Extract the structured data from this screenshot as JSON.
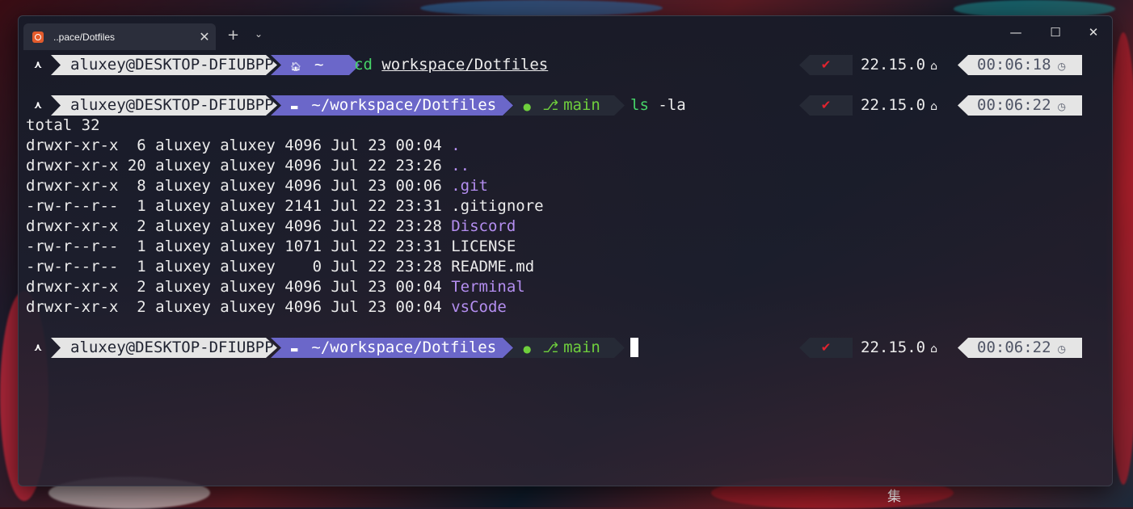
{
  "window": {
    "tab_title": "..pace/Dotfiles",
    "tab_close": "✕",
    "new_tab": "+",
    "dropdown": "⌄",
    "minimize": "—",
    "maximize": "☐",
    "close": "✕"
  },
  "prompts": [
    {
      "user": "aluxey@DESKTOP-DFIUBPP",
      "path_icon": "home-icon",
      "path": "~",
      "git_branch": null,
      "command_name": "cd",
      "command_arg": "workspace/Dotfiles",
      "status": "✔",
      "node_version": "22.15.0",
      "time": "00:06:18"
    },
    {
      "user": "aluxey@DESKTOP-DFIUBPP",
      "path_icon": "folder-icon",
      "path": "~/workspace/Dotfiles",
      "git_branch": "main",
      "command_name": "ls",
      "command_arg": "-la",
      "status": "✔",
      "node_version": "22.15.0",
      "time": "00:06:22"
    },
    {
      "user": "aluxey@DESKTOP-DFIUBPP",
      "path_icon": "folder-icon",
      "path": "~/workspace/Dotfiles",
      "git_branch": "main",
      "command_name": "",
      "command_arg": "",
      "status": "✔",
      "node_version": "22.15.0",
      "time": "00:06:22"
    }
  ],
  "ls_output": {
    "total": "total 32",
    "entries": [
      {
        "perms": "drwxr-xr-x",
        "links": " 6",
        "owner": "aluxey",
        "group": "aluxey",
        "size": "4096",
        "month": "Jul",
        "day": "23",
        "time": "00:04",
        "name": ".",
        "is_dir": true
      },
      {
        "perms": "drwxr-xr-x",
        "links": "20",
        "owner": "aluxey",
        "group": "aluxey",
        "size": "4096",
        "month": "Jul",
        "day": "22",
        "time": "23:26",
        "name": "..",
        "is_dir": true
      },
      {
        "perms": "drwxr-xr-x",
        "links": " 8",
        "owner": "aluxey",
        "group": "aluxey",
        "size": "4096",
        "month": "Jul",
        "day": "23",
        "time": "00:06",
        "name": ".git",
        "is_dir": true
      },
      {
        "perms": "-rw-r--r--",
        "links": " 1",
        "owner": "aluxey",
        "group": "aluxey",
        "size": "2141",
        "month": "Jul",
        "day": "22",
        "time": "23:31",
        "name": ".gitignore",
        "is_dir": false
      },
      {
        "perms": "drwxr-xr-x",
        "links": " 2",
        "owner": "aluxey",
        "group": "aluxey",
        "size": "4096",
        "month": "Jul",
        "day": "22",
        "time": "23:28",
        "name": "Discord",
        "is_dir": true
      },
      {
        "perms": "-rw-r--r--",
        "links": " 1",
        "owner": "aluxey",
        "group": "aluxey",
        "size": "1071",
        "month": "Jul",
        "day": "22",
        "time": "23:31",
        "name": "LICENSE",
        "is_dir": false
      },
      {
        "perms": "-rw-r--r--",
        "links": " 1",
        "owner": "aluxey",
        "group": "aluxey",
        "size": "   0",
        "month": "Jul",
        "day": "22",
        "time": "23:28",
        "name": "README.md",
        "is_dir": false
      },
      {
        "perms": "drwxr-xr-x",
        "links": " 2",
        "owner": "aluxey",
        "group": "aluxey",
        "size": "4096",
        "month": "Jul",
        "day": "23",
        "time": "00:04",
        "name": "Terminal",
        "is_dir": true
      },
      {
        "perms": "drwxr-xr-x",
        "links": " 2",
        "owner": "aluxey",
        "group": "aluxey",
        "size": "4096",
        "month": "Jul",
        "day": "23",
        "time": "00:04",
        "name": "vsCode",
        "is_dir": true
      }
    ]
  },
  "colors": {
    "user_segment_bg": "#e5e5e5",
    "path_segment_bg": "#6b67c9",
    "git_text": "#6fcf3d",
    "command_color": "#46d468",
    "status_color": "#e0232f",
    "directory_color": "#b48ef0"
  },
  "taskbar": {
    "ime_indicator": "集"
  }
}
